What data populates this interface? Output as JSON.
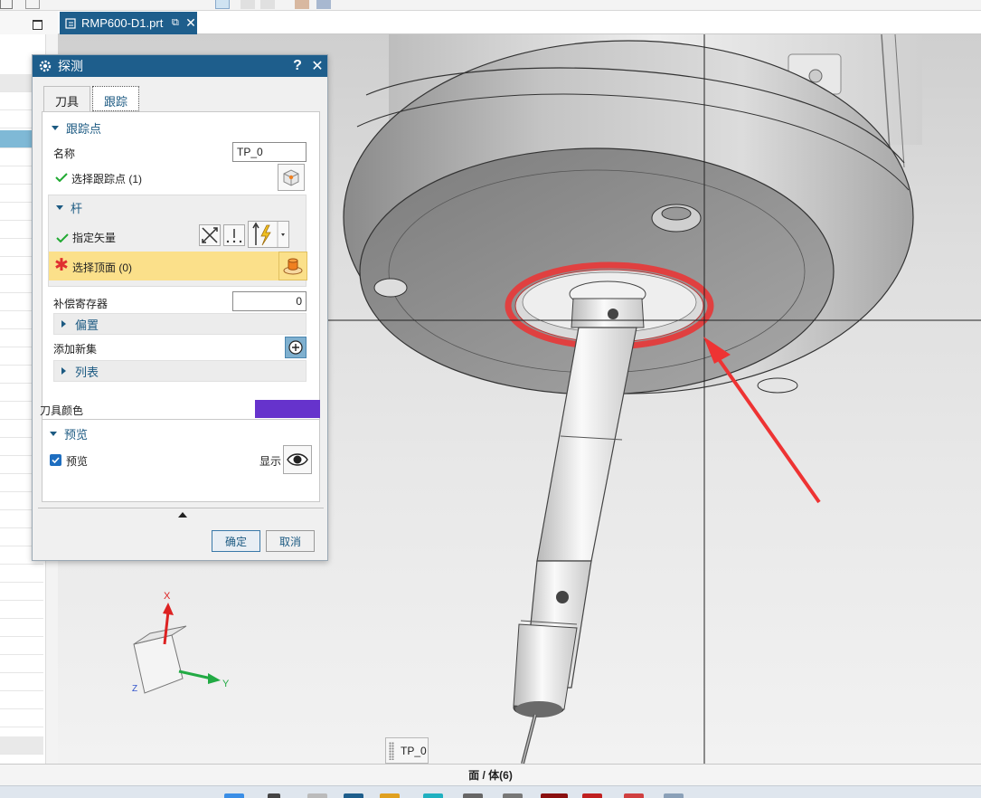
{
  "file_tab": {
    "name": "RMP600-D1.prt",
    "close": "✕"
  },
  "dialog": {
    "title": "探测",
    "help": "?",
    "close": "✕",
    "tabs": [
      {
        "label": "刀具"
      },
      {
        "label": "跟踪"
      }
    ],
    "track_point": {
      "header": "跟踪点",
      "name_label": "名称",
      "name_value": "TP_0",
      "select_point_label": "选择跟踪点 (1)"
    },
    "shank": {
      "header": "杆",
      "specify_vector_label": "指定矢量",
      "select_top_face_label": "选择顶面 (0)"
    },
    "offset_register_label": "补偿寄存器",
    "offset_register_value": "0",
    "offset_header": "偏置",
    "add_new_set_label": "添加新集",
    "list_header": "列表",
    "tool_color_label": "刀具颜色",
    "tool_color": "#6633cc",
    "preview": {
      "header": "预览",
      "checkbox_label": "预览",
      "checked": true,
      "show_label": "显示"
    },
    "ok_label": "确定",
    "cancel_label": "取消"
  },
  "viewport": {
    "triad": {
      "x": "X",
      "y": "Y",
      "z": "Z"
    },
    "tp_label": "TP_0"
  },
  "status_bar": {
    "text": "面 / 体(6)"
  },
  "colors": {
    "title_bar": "#1e5e8c",
    "highlight_ring": "#e04040",
    "annotation_arrow": "#ee3333",
    "selection_row": "#fbe08a"
  }
}
